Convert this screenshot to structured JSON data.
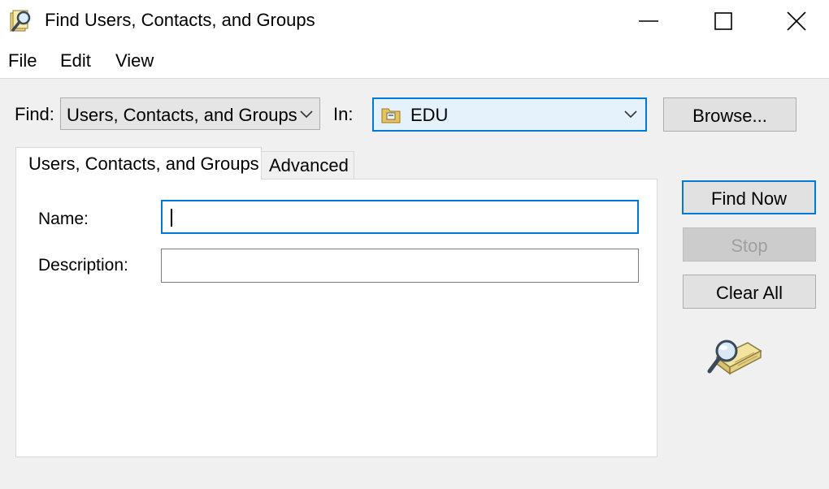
{
  "window": {
    "title": "Find Users, Contacts, and Groups",
    "icon": "find-icon"
  },
  "menu": {
    "file": "File",
    "edit": "Edit",
    "view": "View"
  },
  "find": {
    "label": "Find:",
    "value": "Users, Contacts, and Groups"
  },
  "in": {
    "label": "In:",
    "value": "EDU",
    "icon": "domain-folder-icon"
  },
  "buttons": {
    "browse": "Browse...",
    "find_now": "Find Now",
    "stop": "Stop",
    "clear_all": "Clear All"
  },
  "tabs": {
    "users": "Users, Contacts, and Groups",
    "advanced": "Advanced"
  },
  "fields": {
    "name_label": "Name:",
    "name_value": "",
    "description_label": "Description:",
    "description_value": ""
  },
  "colors": {
    "accent": "#0078d7",
    "window_bg": "#f0f0f0"
  }
}
